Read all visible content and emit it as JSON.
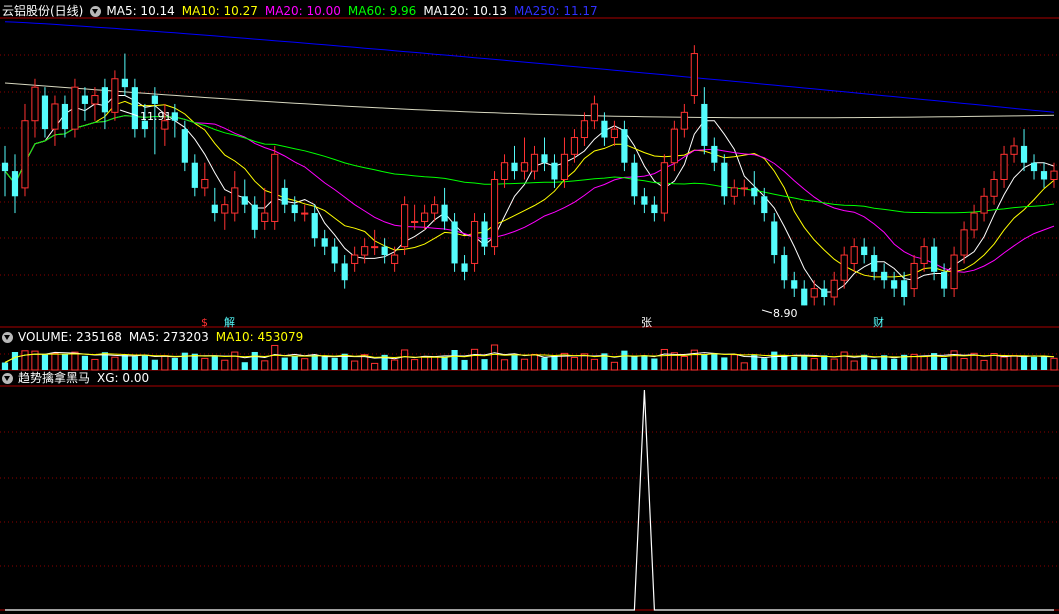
{
  "header": {
    "stock_name": "云铝股份(日线)",
    "ma": [
      {
        "label": "MA5: 10.14",
        "color": "#ffffff"
      },
      {
        "label": "MA10: 10.27",
        "color": "#ffff00"
      },
      {
        "label": "MA20: 10.00",
        "color": "#ff00ff"
      },
      {
        "label": "MA60: 9.96",
        "color": "#00ff00"
      },
      {
        "label": "MA120: 10.13",
        "color": "#ffffff"
      },
      {
        "label": "MA250: 11.17",
        "color": "#0000ff"
      }
    ]
  },
  "volume_header": {
    "volume": "VOLUME: 235168",
    "ma5": "MA5: 273203",
    "ma10": "MA10: 453079"
  },
  "indicator_header": {
    "name": "趋势擒拿黑马",
    "xg": "XG: 0.00"
  },
  "annotations": {
    "high_label": "11.91",
    "low_label": "8.90",
    "markers": [
      "$",
      "解",
      "张",
      "财"
    ]
  },
  "colors": {
    "up": "#ff3232",
    "down": "#54fcfc",
    "grid": "#8b0000",
    "ma5": "#ffffff",
    "ma10": "#ffff00",
    "ma20": "#ff00ff",
    "ma60": "#00ff00",
    "ma120": "#ffffff",
    "ma250": "#0000ff"
  },
  "chart_data": {
    "type": "candlestick",
    "price_range": [
      8.75,
      12.3
    ],
    "candles": [
      [
        10.6,
        10.5,
        10.8,
        10.2
      ],
      [
        10.5,
        10.2,
        10.7,
        10.0
      ],
      [
        10.3,
        11.1,
        11.3,
        10.2
      ],
      [
        11.1,
        11.5,
        11.6,
        10.9
      ],
      [
        11.4,
        11.0,
        11.5,
        10.9
      ],
      [
        11.0,
        11.3,
        11.4,
        10.8
      ],
      [
        11.3,
        11.0,
        11.4,
        10.9
      ],
      [
        11.0,
        11.5,
        11.6,
        10.9
      ],
      [
        11.4,
        11.3,
        11.5,
        11.1
      ],
      [
        11.3,
        11.4,
        11.5,
        11.1
      ],
      [
        11.5,
        11.2,
        11.6,
        11.0
      ],
      [
        11.2,
        11.6,
        11.7,
        11.1
      ],
      [
        11.6,
        11.5,
        11.9,
        11.4
      ],
      [
        11.5,
        11.0,
        11.6,
        10.9
      ],
      [
        11.1,
        11.0,
        11.3,
        10.9
      ],
      [
        11.4,
        11.3,
        11.5,
        10.7
      ],
      [
        11.0,
        11.1,
        11.3,
        10.8
      ],
      [
        11.2,
        11.1,
        11.3,
        10.9
      ],
      [
        11.0,
        10.6,
        11.1,
        10.5
      ],
      [
        10.6,
        10.3,
        10.7,
        10.2
      ],
      [
        10.3,
        10.4,
        10.6,
        10.2
      ],
      [
        10.1,
        10.0,
        10.3,
        9.9
      ],
      [
        10.0,
        10.1,
        10.2,
        9.8
      ],
      [
        10.0,
        10.3,
        10.5,
        9.9
      ],
      [
        10.2,
        10.1,
        10.4,
        10.0
      ],
      [
        10.1,
        9.8,
        10.2,
        9.7
      ],
      [
        9.9,
        10.0,
        10.3,
        9.8
      ],
      [
        9.9,
        10.7,
        10.8,
        9.8
      ],
      [
        10.3,
        10.1,
        10.4,
        10.0
      ],
      [
        10.1,
        10.0,
        10.2,
        9.9
      ],
      [
        10.0,
        10.0,
        10.1,
        9.9
      ],
      [
        10.0,
        9.7,
        10.1,
        9.6
      ],
      [
        9.7,
        9.6,
        9.8,
        9.5
      ],
      [
        9.6,
        9.4,
        9.7,
        9.3
      ],
      [
        9.4,
        9.2,
        9.5,
        9.1
      ],
      [
        9.4,
        9.5,
        9.6,
        9.3
      ],
      [
        9.5,
        9.6,
        9.7,
        9.4
      ],
      [
        9.6,
        9.6,
        9.8,
        9.5
      ],
      [
        9.6,
        9.5,
        9.7,
        9.4
      ],
      [
        9.4,
        9.5,
        9.6,
        9.3
      ],
      [
        9.6,
        10.1,
        10.2,
        9.5
      ],
      [
        9.9,
        9.9,
        10.1,
        9.8
      ],
      [
        9.9,
        10.0,
        10.1,
        9.8
      ],
      [
        10.0,
        10.1,
        10.2,
        9.9
      ],
      [
        10.1,
        9.9,
        10.3,
        9.8
      ],
      [
        9.9,
        9.4,
        10.0,
        9.3
      ],
      [
        9.4,
        9.3,
        9.5,
        9.2
      ],
      [
        9.4,
        9.9,
        10.0,
        9.3
      ],
      [
        9.9,
        9.6,
        10.0,
        9.5
      ],
      [
        9.6,
        10.4,
        10.5,
        9.5
      ],
      [
        10.4,
        10.6,
        10.7,
        10.3
      ],
      [
        10.6,
        10.5,
        10.8,
        10.4
      ],
      [
        10.5,
        10.6,
        10.9,
        10.4
      ],
      [
        10.5,
        10.7,
        10.8,
        10.4
      ],
      [
        10.7,
        10.6,
        10.9,
        10.5
      ],
      [
        10.6,
        10.4,
        10.7,
        10.3
      ],
      [
        10.4,
        10.7,
        10.9,
        10.3
      ],
      [
        10.7,
        10.9,
        11.0,
        10.6
      ],
      [
        10.9,
        11.1,
        11.2,
        10.8
      ],
      [
        11.1,
        11.3,
        11.4,
        11.0
      ],
      [
        11.1,
        10.9,
        11.2,
        10.8
      ],
      [
        10.9,
        11.0,
        11.1,
        10.8
      ],
      [
        11.0,
        10.6,
        11.1,
        10.5
      ],
      [
        10.6,
        10.2,
        10.7,
        10.1
      ],
      [
        10.2,
        10.1,
        10.3,
        10.0
      ],
      [
        10.1,
        10.0,
        10.2,
        9.9
      ],
      [
        10.0,
        10.6,
        10.7,
        9.9
      ],
      [
        10.6,
        11.0,
        11.1,
        10.5
      ],
      [
        11.0,
        11.2,
        11.3,
        10.9
      ],
      [
        11.4,
        11.9,
        12.0,
        11.3
      ],
      [
        11.3,
        10.8,
        11.5,
        10.7
      ],
      [
        10.8,
        10.6,
        10.9,
        10.5
      ],
      [
        10.6,
        10.2,
        10.7,
        10.1
      ],
      [
        10.2,
        10.3,
        10.4,
        10.1
      ],
      [
        10.3,
        10.3,
        10.4,
        10.2
      ],
      [
        10.3,
        10.2,
        10.5,
        10.1
      ],
      [
        10.2,
        10.0,
        10.3,
        9.9
      ],
      [
        9.9,
        9.5,
        10.0,
        9.4
      ],
      [
        9.5,
        9.2,
        9.6,
        9.1
      ],
      [
        9.2,
        9.1,
        9.3,
        9.0
      ],
      [
        9.1,
        8.9,
        9.2,
        8.9
      ],
      [
        9.0,
        9.1,
        9.2,
        8.9
      ],
      [
        9.1,
        9.0,
        9.2,
        8.9
      ],
      [
        9.0,
        9.2,
        9.3,
        8.9
      ],
      [
        9.2,
        9.5,
        9.6,
        9.1
      ],
      [
        9.4,
        9.6,
        9.7,
        9.3
      ],
      [
        9.6,
        9.5,
        9.7,
        9.4
      ],
      [
        9.5,
        9.3,
        9.6,
        9.2
      ],
      [
        9.3,
        9.2,
        9.4,
        9.1
      ],
      [
        9.2,
        9.1,
        9.3,
        9.0
      ],
      [
        9.2,
        9.0,
        9.3,
        8.9
      ],
      [
        9.1,
        9.4,
        9.5,
        9.0
      ],
      [
        9.4,
        9.6,
        9.7,
        9.3
      ],
      [
        9.6,
        9.3,
        9.7,
        9.2
      ],
      [
        9.3,
        9.1,
        9.4,
        9.0
      ],
      [
        9.1,
        9.5,
        9.6,
        9.0
      ],
      [
        9.5,
        9.8,
        9.9,
        9.4
      ],
      [
        9.8,
        10.0,
        10.1,
        9.7
      ],
      [
        10.0,
        10.2,
        10.3,
        9.9
      ],
      [
        10.2,
        10.4,
        10.5,
        10.1
      ],
      [
        10.4,
        10.7,
        10.8,
        10.3
      ],
      [
        10.7,
        10.8,
        10.9,
        10.6
      ],
      [
        10.8,
        10.6,
        11.0,
        10.5
      ],
      [
        10.6,
        10.5,
        10.7,
        10.4
      ],
      [
        10.5,
        10.4,
        10.6,
        10.3
      ],
      [
        10.4,
        10.5,
        10.6,
        10.3
      ]
    ],
    "volume_ma": {
      "ma5": 273203,
      "ma10": 453079
    },
    "xg_signal_bar_index": 64,
    "xg_value_last": 0.0
  }
}
